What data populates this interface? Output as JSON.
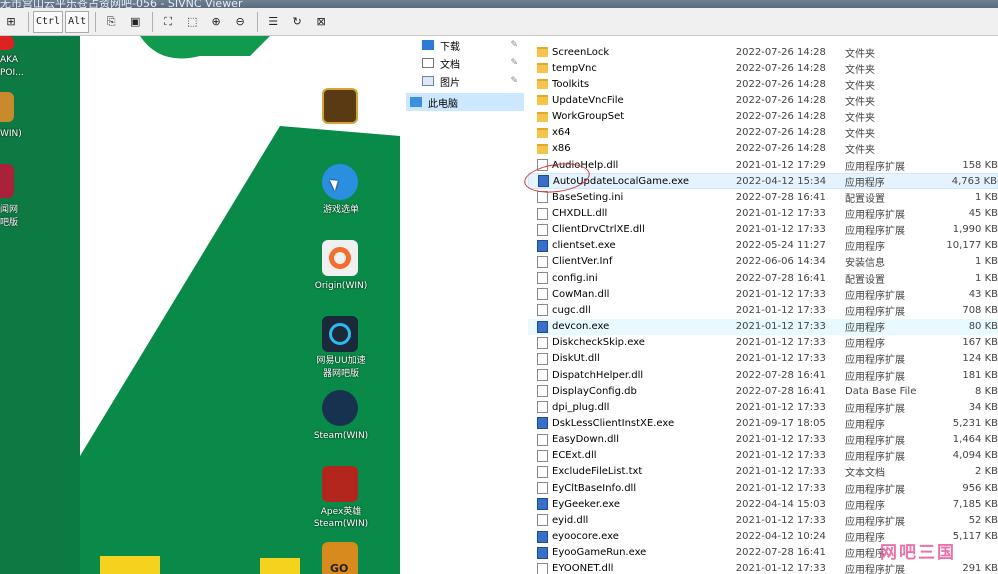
{
  "window": {
    "title": "无市宫山云平乐苍占资网吧-056 - SIVNC Viewer"
  },
  "toolbar": {
    "buttons": [
      {
        "name": "ctrl-alt-del-icon",
        "glyph": "⊞"
      },
      {
        "name": "ctrl-key",
        "label": "Ctrl"
      },
      {
        "name": "alt-key",
        "label": "Alt"
      },
      {
        "name": "copy-icon",
        "glyph": "⎘"
      },
      {
        "name": "picture-icon",
        "glyph": "▣"
      },
      {
        "name": "fullscreen-icon",
        "glyph": "⛶"
      },
      {
        "name": "fit-icon",
        "glyph": "⬚"
      },
      {
        "name": "zoom-in-icon",
        "glyph": "⊕"
      },
      {
        "name": "zoom-out-icon",
        "glyph": "⊖"
      },
      {
        "name": "options-icon",
        "glyph": "☰"
      },
      {
        "name": "refresh-icon",
        "glyph": "↻"
      },
      {
        "name": "disconnect-icon",
        "glyph": "⊠"
      }
    ]
  },
  "desktop": {
    "left_labels": [
      {
        "text": "AKA"
      },
      {
        "text": "POI..."
      },
      {
        "text": "WIN)"
      },
      {
        "text": "闻网"
      },
      {
        "text": "吧版"
      }
    ],
    "icons": [
      {
        "label": ""
      },
      {
        "label": "游戏选单"
      },
      {
        "label": "Origin(WIN)"
      },
      {
        "label": "网易UU加速"
      },
      {
        "label": "器网吧版"
      },
      {
        "label": "Steam(WIN)"
      },
      {
        "label": "Apex英雄"
      },
      {
        "label": "Steam(WIN)"
      },
      {
        "label": "GO"
      }
    ],
    "colors": {
      "green": "#0a8a48",
      "dark_green": "#0e7a43"
    }
  },
  "nav": {
    "items": [
      {
        "label": "下载",
        "pinned": true
      },
      {
        "label": "文档",
        "pinned": true
      },
      {
        "label": "图片",
        "pinned": true
      },
      {
        "label": "此电脑",
        "selected": true
      }
    ]
  },
  "files": [
    {
      "name": "ScreenLock",
      "date": "2022-07-26 14:28",
      "type": "文件夹",
      "size": "",
      "icon": "folder"
    },
    {
      "name": "tempVnc",
      "date": "2022-07-26 14:28",
      "type": "文件夹",
      "size": "",
      "icon": "folder"
    },
    {
      "name": "Toolkits",
      "date": "2022-07-26 14:28",
      "type": "文件夹",
      "size": "",
      "icon": "folder"
    },
    {
      "name": "UpdateVncFile",
      "date": "2022-07-26 14:28",
      "type": "文件夹",
      "size": "",
      "icon": "folder"
    },
    {
      "name": "WorkGroupSet",
      "date": "2022-07-26 14:28",
      "type": "文件夹",
      "size": "",
      "icon": "folder"
    },
    {
      "name": "x64",
      "date": "2022-07-26 14:28",
      "type": "文件夹",
      "size": "",
      "icon": "folder"
    },
    {
      "name": "x86",
      "date": "2022-07-26 14:28",
      "type": "文件夹",
      "size": "",
      "icon": "folder"
    },
    {
      "name": "AudioHelp.dll",
      "date": "2021-01-12 17:29",
      "type": "应用程序扩展",
      "size": "158 KB",
      "icon": "doc"
    },
    {
      "name": "AutoUpdateLocalGame.exe",
      "date": "2022-04-12 15:34",
      "type": "应用程序",
      "size": "4,763 KB",
      "icon": "exe",
      "selected": true
    },
    {
      "name": "BaseSeting.ini",
      "date": "2022-07-28 16:41",
      "type": "配置设置",
      "size": "1 KB",
      "icon": "doc"
    },
    {
      "name": "CHXDLL.dll",
      "date": "2021-01-12 17:33",
      "type": "应用程序扩展",
      "size": "45 KB",
      "icon": "doc"
    },
    {
      "name": "ClientDrvCtrlXE.dll",
      "date": "2021-01-12 17:33",
      "type": "应用程序扩展",
      "size": "1,990 KB",
      "icon": "doc"
    },
    {
      "name": "clientset.exe",
      "date": "2022-05-24 11:27",
      "type": "应用程序",
      "size": "10,177 KB",
      "icon": "exe"
    },
    {
      "name": "ClientVer.Inf",
      "date": "2022-06-06 14:34",
      "type": "安装信息",
      "size": "1 KB",
      "icon": "doc"
    },
    {
      "name": "config.ini",
      "date": "2022-07-28 16:41",
      "type": "配置设置",
      "size": "1 KB",
      "icon": "doc"
    },
    {
      "name": "CowMan.dll",
      "date": "2021-01-12 17:33",
      "type": "应用程序扩展",
      "size": "43 KB",
      "icon": "doc"
    },
    {
      "name": "cugc.dll",
      "date": "2021-01-12 17:33",
      "type": "应用程序扩展",
      "size": "708 KB",
      "icon": "doc"
    },
    {
      "name": "devcon.exe",
      "date": "2021-01-12 17:33",
      "type": "应用程序",
      "size": "80 KB",
      "icon": "exe",
      "highlight": true
    },
    {
      "name": "DiskcheckSkip.exe",
      "date": "2021-01-12 17:33",
      "type": "应用程序",
      "size": "167 KB",
      "icon": "doc"
    },
    {
      "name": "DiskUt.dll",
      "date": "2021-01-12 17:33",
      "type": "应用程序扩展",
      "size": "124 KB",
      "icon": "doc"
    },
    {
      "name": "DispatchHelper.dll",
      "date": "2022-07-28 16:41",
      "type": "应用程序扩展",
      "size": "181 KB",
      "icon": "doc"
    },
    {
      "name": "DisplayConfig.db",
      "date": "2022-07-28 16:41",
      "type": "Data Base File",
      "size": "8 KB",
      "icon": "doc"
    },
    {
      "name": "dpi_plug.dll",
      "date": "2021-01-12 17:33",
      "type": "应用程序扩展",
      "size": "34 KB",
      "icon": "doc"
    },
    {
      "name": "DskLessClientInstXE.exe",
      "date": "2021-09-17 18:05",
      "type": "应用程序",
      "size": "5,231 KB",
      "icon": "exe"
    },
    {
      "name": "EasyDown.dll",
      "date": "2021-01-12 17:33",
      "type": "应用程序扩展",
      "size": "1,464 KB",
      "icon": "doc"
    },
    {
      "name": "ECExt.dll",
      "date": "2021-01-12 17:33",
      "type": "应用程序扩展",
      "size": "4,094 KB",
      "icon": "doc"
    },
    {
      "name": "ExcludeFileList.txt",
      "date": "2021-01-12 17:33",
      "type": "文本文档",
      "size": "2 KB",
      "icon": "doc"
    },
    {
      "name": "EyCltBaseInfo.dll",
      "date": "2021-01-12 17:33",
      "type": "应用程序扩展",
      "size": "956 KB",
      "icon": "doc"
    },
    {
      "name": "EyGeeker.exe",
      "date": "2022-04-14 15:03",
      "type": "应用程序",
      "size": "7,185 KB",
      "icon": "exe"
    },
    {
      "name": "eyid.dll",
      "date": "2021-01-12 17:33",
      "type": "应用程序扩展",
      "size": "52 KB",
      "icon": "doc"
    },
    {
      "name": "eyoocore.exe",
      "date": "2022-04-12 10:24",
      "type": "应用程序",
      "size": "5,117 KB",
      "icon": "exe"
    },
    {
      "name": "EyooGameRun.exe",
      "date": "2022-07-28 16:41",
      "type": "应用程序",
      "size": "",
      "icon": "exe"
    },
    {
      "name": "EYOONET.dll",
      "date": "2021-01-12 17:33",
      "type": "应用程序扩展",
      "size": "291 KB",
      "icon": "doc"
    }
  ],
  "watermark": {
    "text": "网吧三国"
  }
}
